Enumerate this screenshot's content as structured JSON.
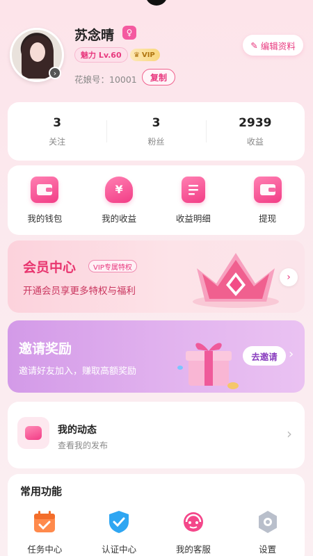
{
  "profile": {
    "name": "苏念晴",
    "charm_level": "魅力 Lv.60",
    "vip_label": "VIP",
    "id_text": "花娘号：10001",
    "copy_label": "复制",
    "edit_label": "编辑资料"
  },
  "stats": [
    {
      "value": "3",
      "label": "关注"
    },
    {
      "value": "3",
      "label": "粉丝"
    },
    {
      "value": "2939",
      "label": "收益"
    }
  ],
  "wallet_items": [
    {
      "label": "我的钱包",
      "icon": "wallet-icon"
    },
    {
      "label": "我的收益",
      "icon": "money-bag-icon"
    },
    {
      "label": "收益明细",
      "icon": "receipt-icon"
    },
    {
      "label": "提现",
      "icon": "withdraw-icon"
    }
  ],
  "member": {
    "title": "会员中心",
    "tag": "VIP专属特权",
    "subtitle": "开通会员享更多特权与福利"
  },
  "invite": {
    "title": "邀请奖励",
    "subtitle": "邀请好友加入，赚取高额奖励",
    "button": "去邀请"
  },
  "dynamics": {
    "title": "我的动态",
    "subtitle": "查看我的发布"
  },
  "common": {
    "title": "常用功能",
    "items": [
      {
        "label": "任务中心",
        "icon": "task-calendar-icon"
      },
      {
        "label": "认证中心",
        "icon": "verify-shield-icon"
      },
      {
        "label": "我的客服",
        "icon": "customer-service-icon"
      },
      {
        "label": "设置",
        "icon": "settings-gear-icon"
      }
    ]
  },
  "colors": {
    "accent": "#e8387e",
    "invite_purple": "#d39ae8"
  }
}
